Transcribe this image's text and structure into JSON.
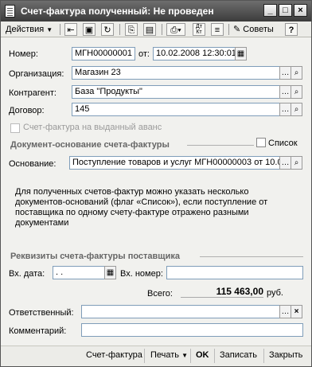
{
  "window": {
    "title": "Счет-фактура полученный: Не проведен",
    "min_label": "_",
    "max_label": "□",
    "close_label": "×"
  },
  "toolbar": {
    "actions_label": "Действия",
    "tips_label": "Советы",
    "help_label": "?",
    "icons": [
      "go-back-icon",
      "post-document-icon",
      "refresh-icon",
      "copy-document-icon",
      "print-icon",
      "based-on-icon",
      "debit-credit-icon",
      "report-icon"
    ]
  },
  "form": {
    "number_label": "Номер:",
    "number_value": "МГН00000001",
    "date_label": "от:",
    "date_value": "10.02.2008 12:30:01",
    "organization_label": "Организация:",
    "organization_value": "Магазин 23",
    "counterparty_label": "Контрагент:",
    "counterparty_value": "База \"Продукты\"",
    "contract_label": "Договор:",
    "contract_value": "145",
    "advance_label": "Счет-фактура на выданный аванс",
    "basis_section_title": "Документ-основание счета-фактуры",
    "list_label": "Список",
    "basis_label": "Основание:",
    "basis_value": "Поступление товаров и услуг МГН00000003 от 10.0",
    "note": [
      "Для полученных счетов-фактур можно указать несколько",
      "документов-оснований (флаг «Список»), если поступление от",
      "поставщика по одному счету-фактуре отражено разными",
      "документами"
    ],
    "supplier_section_title": "Реквизиты счета-фактуры поставщика",
    "in_date_label": "Вх. дата:",
    "in_date_value": ". .",
    "in_number_label": "Вх. номер:",
    "in_number_value": "",
    "total_label": "Всего:",
    "total_value": "115 463,00",
    "currency": "руб.",
    "responsible_label": "Ответственный:",
    "responsible_value": "",
    "comment_label": "Комментарий:",
    "comment_value": ""
  },
  "bottom": {
    "invoice_label": "Счет-фактура",
    "print_label": "Печать",
    "ok_label": "OK",
    "save_label": "Записать",
    "close_label": "Закрыть"
  }
}
